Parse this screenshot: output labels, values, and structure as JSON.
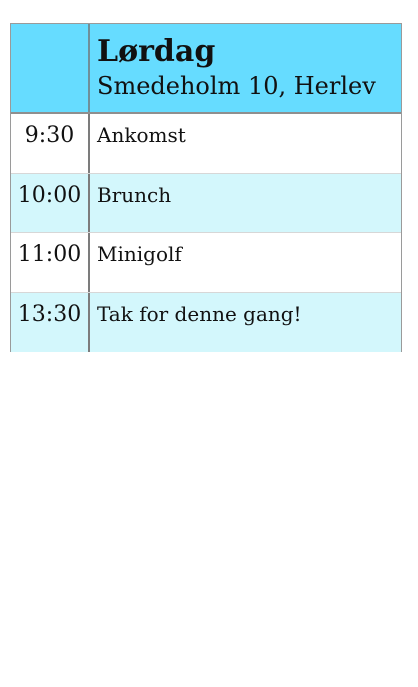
{
  "schedule": {
    "day": "Lørdag",
    "address": "Smedeholm 10, Herlev",
    "rows": [
      {
        "time": "9:30",
        "activity": "Ankomst"
      },
      {
        "time": "10:00",
        "activity": "Brunch"
      },
      {
        "time": "11:00",
        "activity": "Minigolf"
      },
      {
        "time": "13:30",
        "activity": "Tak for denne gang!"
      }
    ],
    "colors": {
      "header_background": "#66dcff",
      "alternate_row": "#d3f7fc"
    }
  }
}
